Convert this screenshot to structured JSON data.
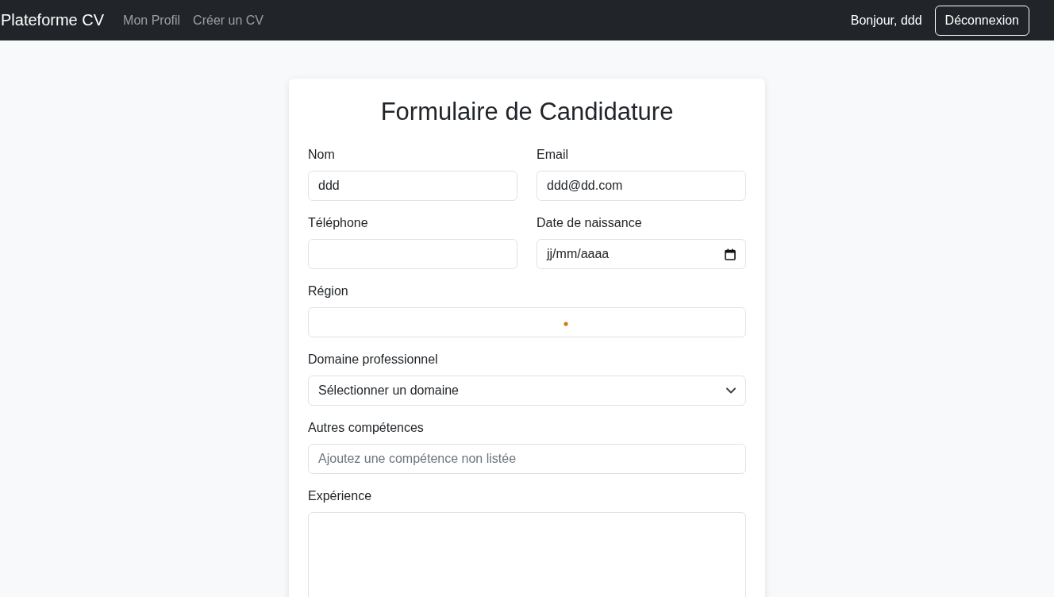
{
  "navbar": {
    "brand": "Plateforme CV",
    "links": [
      "Mon Profil",
      "Créer un CV"
    ],
    "greeting": "Bonjour, ddd",
    "logout_button": "Déconnexion"
  },
  "form": {
    "title": "Formulaire de Candidature",
    "rows": [
      {
        "fields": [
          {
            "kind": "text",
            "label": "Nom",
            "value": "ddd"
          },
          {
            "kind": "text",
            "label": "Email",
            "value": "ddd@dd.com"
          }
        ]
      },
      {
        "fields": [
          {
            "kind": "text",
            "label": "Téléphone"
          },
          {
            "kind": "date",
            "label": "Date de naissance",
            "value": "jj/mm/aaaa"
          }
        ]
      },
      {
        "fields": [
          {
            "kind": "loading",
            "label": "Région"
          }
        ]
      },
      {
        "fields": [
          {
            "kind": "select",
            "label": "Domaine professionnel",
            "value": "Sélectionner un domaine"
          }
        ]
      },
      {
        "fields": [
          {
            "kind": "text",
            "label": "Autres compétences",
            "placeholder": "Ajoutez une compétence non listée"
          }
        ]
      },
      {
        "fields": [
          {
            "kind": "textarea",
            "label": "Expérience"
          }
        ]
      }
    ]
  }
}
